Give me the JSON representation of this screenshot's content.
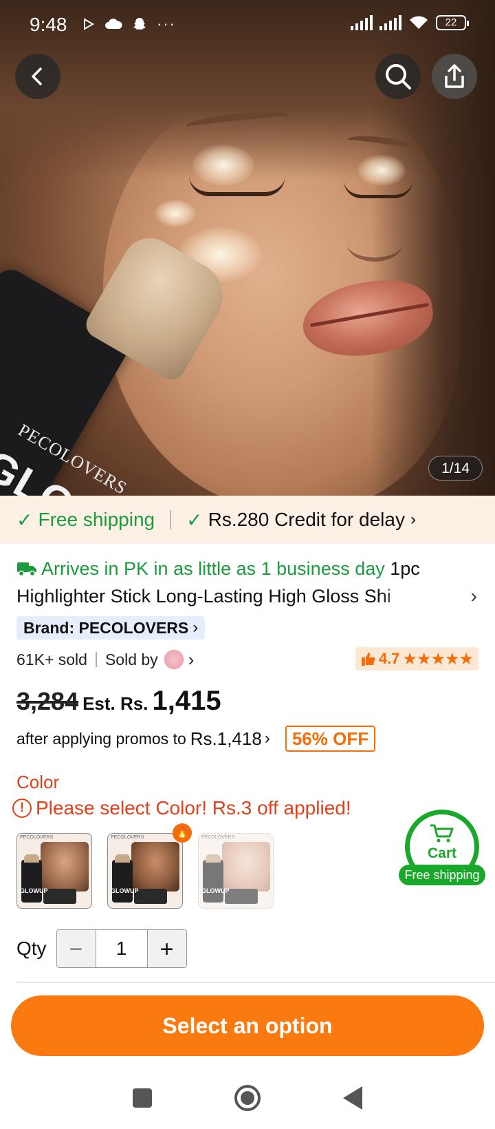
{
  "status_bar": {
    "time": "9:48",
    "left_icons": [
      "play-store-icon",
      "cloud-icon",
      "snapchat-icon",
      "more-dots-icon"
    ],
    "battery": "22"
  },
  "hero": {
    "image_brand_text": "PECOLOVERS",
    "image_product_text": "GLOWUP",
    "counter": "1/14"
  },
  "shipping_banner": {
    "free_shipping": "Free shipping",
    "credit": "Rs.280 Credit for delay"
  },
  "product": {
    "arrival": "Arrives in PK in as little as 1 business day",
    "title_start": "1pc",
    "title": "Highlighter Stick Long-Lasting High Gloss Shi",
    "brand": "Brand: PECOLOVERS",
    "sold": "61K+ sold",
    "sold_by": "Sold by",
    "rating": "4.7",
    "stars": "★★★★★"
  },
  "pricing": {
    "old_price": "3,284",
    "est_label": "Est. Rs.",
    "new_price": "1,415",
    "promo_text": "after applying promos to",
    "promo_amount": "Rs.1,418",
    "discount": "56% OFF"
  },
  "options": {
    "color_label": "Color",
    "warning": "Please select Color! Rs.3 off applied!",
    "swatches": [
      {
        "brand": "PECOLOVERS",
        "label": "GLOWUP",
        "state": "normal"
      },
      {
        "brand": "PECOLOVERS",
        "label": "GLOWUP",
        "state": "hot"
      },
      {
        "brand": "PECOLOVERS",
        "label": "GLOWUP",
        "state": "soldout"
      }
    ]
  },
  "cart": {
    "label": "Cart",
    "shipping": "Free shipping"
  },
  "quantity": {
    "label": "Qty",
    "value": "1",
    "minus": "−",
    "plus": "+"
  },
  "cta": {
    "label": "Select an option"
  },
  "colors": {
    "accent_orange": "#fb7a0f",
    "green": "#1a9c3e",
    "warning_red": "#e0401a",
    "banner_bg": "#fdf0e4"
  }
}
